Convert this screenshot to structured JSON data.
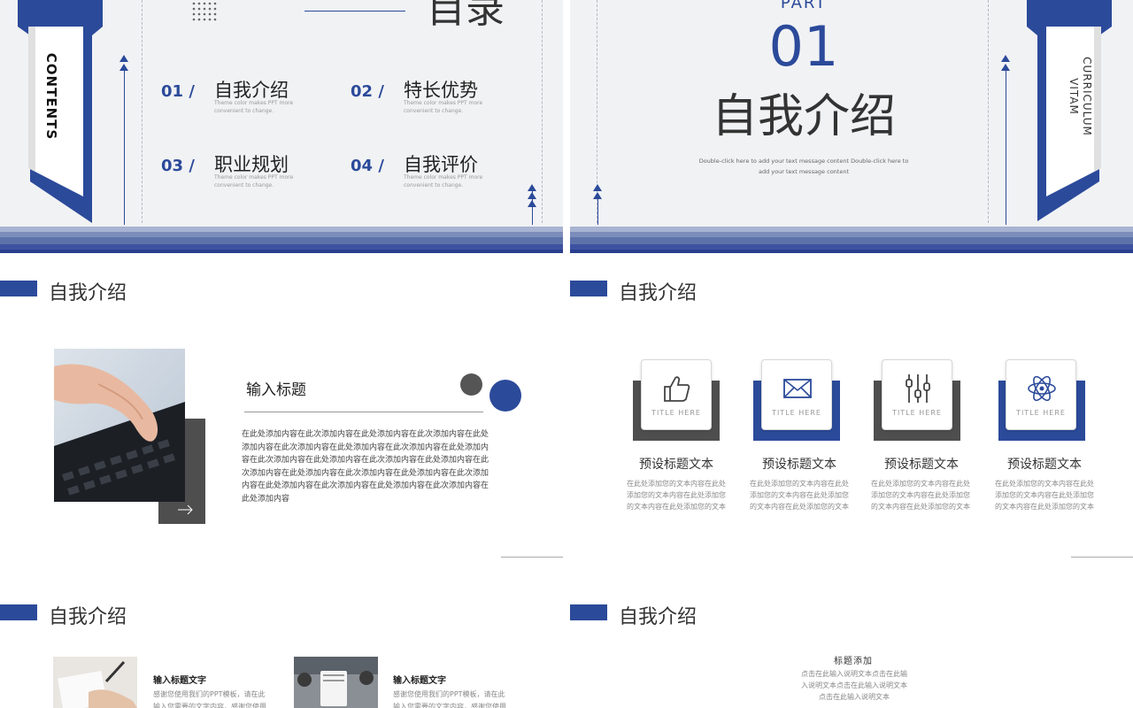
{
  "slide1": {
    "heading": "目录",
    "side_label": "CONTENTS",
    "items": [
      {
        "num": "01 /",
        "title": "自我介绍",
        "sub": "Theme color makes PPT more convenient to change."
      },
      {
        "num": "02 /",
        "title": "特长优势",
        "sub": "Theme color makes PPT more convenient to change."
      },
      {
        "num": "03 /",
        "title": "职业规划",
        "sub": "Theme color makes PPT more convenient to change."
      },
      {
        "num": "04 /",
        "title": "自我评价",
        "sub": "Theme color makes PPT more convenient to change."
      }
    ]
  },
  "slide2": {
    "part": "PART",
    "number": "01",
    "title": "自我介绍",
    "desc": "Double-click here to add your text message content Double-click here to add your text message content",
    "side_label": "CURRICULUM VITAM"
  },
  "slide3": {
    "section_title": "自我介绍",
    "heading": "输入标题",
    "body": "在此处添加内容在此次添加内容在此处添加内容在此次添加内容在此处添加内容在此次添加内容在此处添加内容在此次添加内容在此处添加内容在此次添加内容在此处添加内容在此次添加内容在此处添加内容在此次添加内容在此处添加内容在此次添加内容在此处添加内容在此次添加内容在此处添加内容在此次添加内容在此处添加内容在此次添加内容在此处添加内容"
  },
  "slide4": {
    "section_title": "自我介绍",
    "cards": [
      {
        "icon": "thumbs-up-icon",
        "label": "TITLE HERE",
        "title": "预设标题文本",
        "body": "在此处添加您的文本内容在此处添加您的文本内容在此处添加您的文本内容在此处添加您的文本"
      },
      {
        "icon": "envelope-icon",
        "label": "TITLE HERE",
        "title": "预设标题文本",
        "body": "在此处添加您的文本内容在此处添加您的文本内容在此处添加您的文本内容在此处添加您的文本"
      },
      {
        "icon": "sliders-icon",
        "label": "TITLE HERE",
        "title": "预设标题文本",
        "body": "在此处添加您的文本内容在此处添加您的文本内容在此处添加您的文本内容在此处添加您的文本"
      },
      {
        "icon": "atom-icon",
        "label": "TITLE HERE",
        "title": "预设标题文本",
        "body": "在此处添加您的文本内容在此处添加您的文本内容在此处添加您的文本内容在此处添加您的文本"
      }
    ]
  },
  "slide5": {
    "section_title": "自我介绍",
    "blocks": [
      {
        "title": "输入标题文字",
        "body": "感谢您使用我们的PPT模板，请在此输入您需要的文字内容，感谢您使用"
      },
      {
        "title": "输入标题文字",
        "body": "感谢您使用我们的PPT模板，请在此输入您需要的文字内容，感谢您使用"
      }
    ]
  },
  "slide6": {
    "section_title": "自我介绍",
    "center_title": "标题添加",
    "center_body": "点击在此输入说明文本点击在此输入说明文本点击在此输入说明文本点击在此输入说明文本"
  },
  "colors": {
    "primary": "#2b4a9a",
    "gray": "#555555"
  }
}
